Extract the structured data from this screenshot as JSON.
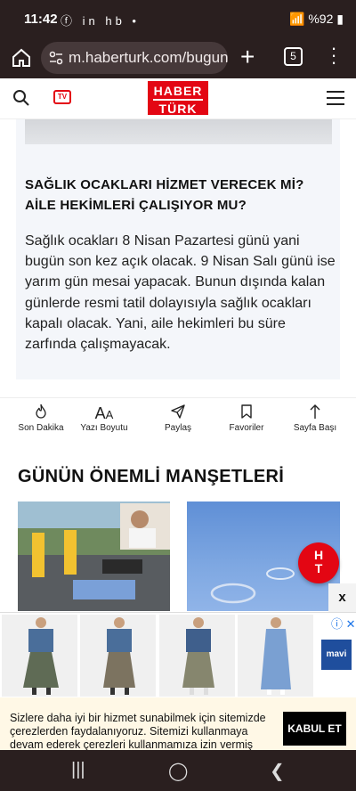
{
  "status": {
    "time": "11:42",
    "notification_icons": "ⓕ in hb •",
    "battery": "%92"
  },
  "browser": {
    "url": "m.haberturk.com/bugun",
    "tab_count": "5"
  },
  "site": {
    "logo_top": "HABER",
    "logo_bottom": "TÜRK",
    "tv_label": "TV"
  },
  "article": {
    "heading": "SAĞLIK OCAKLARI HİZMET VERECEK Mİ? AİLE HEKİMLERİ ÇALIŞIYOR MU?",
    "body": "Sağlık ocakları 8 Nisan Pazartesi günü yani bugün son kez açık olacak. 9 Nisan Salı günü ise yarım gün mesai yapacak. Bunun dışında kalan günlerde resmi tatil dolayısıyla sağlık ocakları kapalı olacak. Yani, aile hekimleri bu süre zarfında çalışmayacak."
  },
  "toolbar": {
    "items": [
      {
        "label": "Son Dakika",
        "icon": "flame-icon"
      },
      {
        "label": "Yazı Boyutu",
        "icon": "font-size-icon"
      },
      {
        "label": "Paylaş",
        "icon": "share-icon"
      },
      {
        "label": "Favoriler",
        "icon": "bookmark-icon"
      },
      {
        "label": "Sayfa Başı",
        "icon": "arrow-up-icon"
      }
    ]
  },
  "headlines": {
    "title": "GÜNÜN ÖNEMLİ MANŞETLERİ",
    "ht_button_top": "H",
    "ht_button_bottom": "T"
  },
  "ad": {
    "close": "x",
    "brand": "mavi"
  },
  "cookie": {
    "text": "Sizlere daha iyi bir hizmet sunabilmek için sitemizde çerezlerden faydalanıyoruz. Sitemizi kullanmaya devam ederek çerezleri kullanmamıza izin vermiş",
    "accept": "KABUL ET"
  },
  "colors": {
    "brand_red": "#e30613",
    "chrome_dark": "#2a1f1f"
  }
}
